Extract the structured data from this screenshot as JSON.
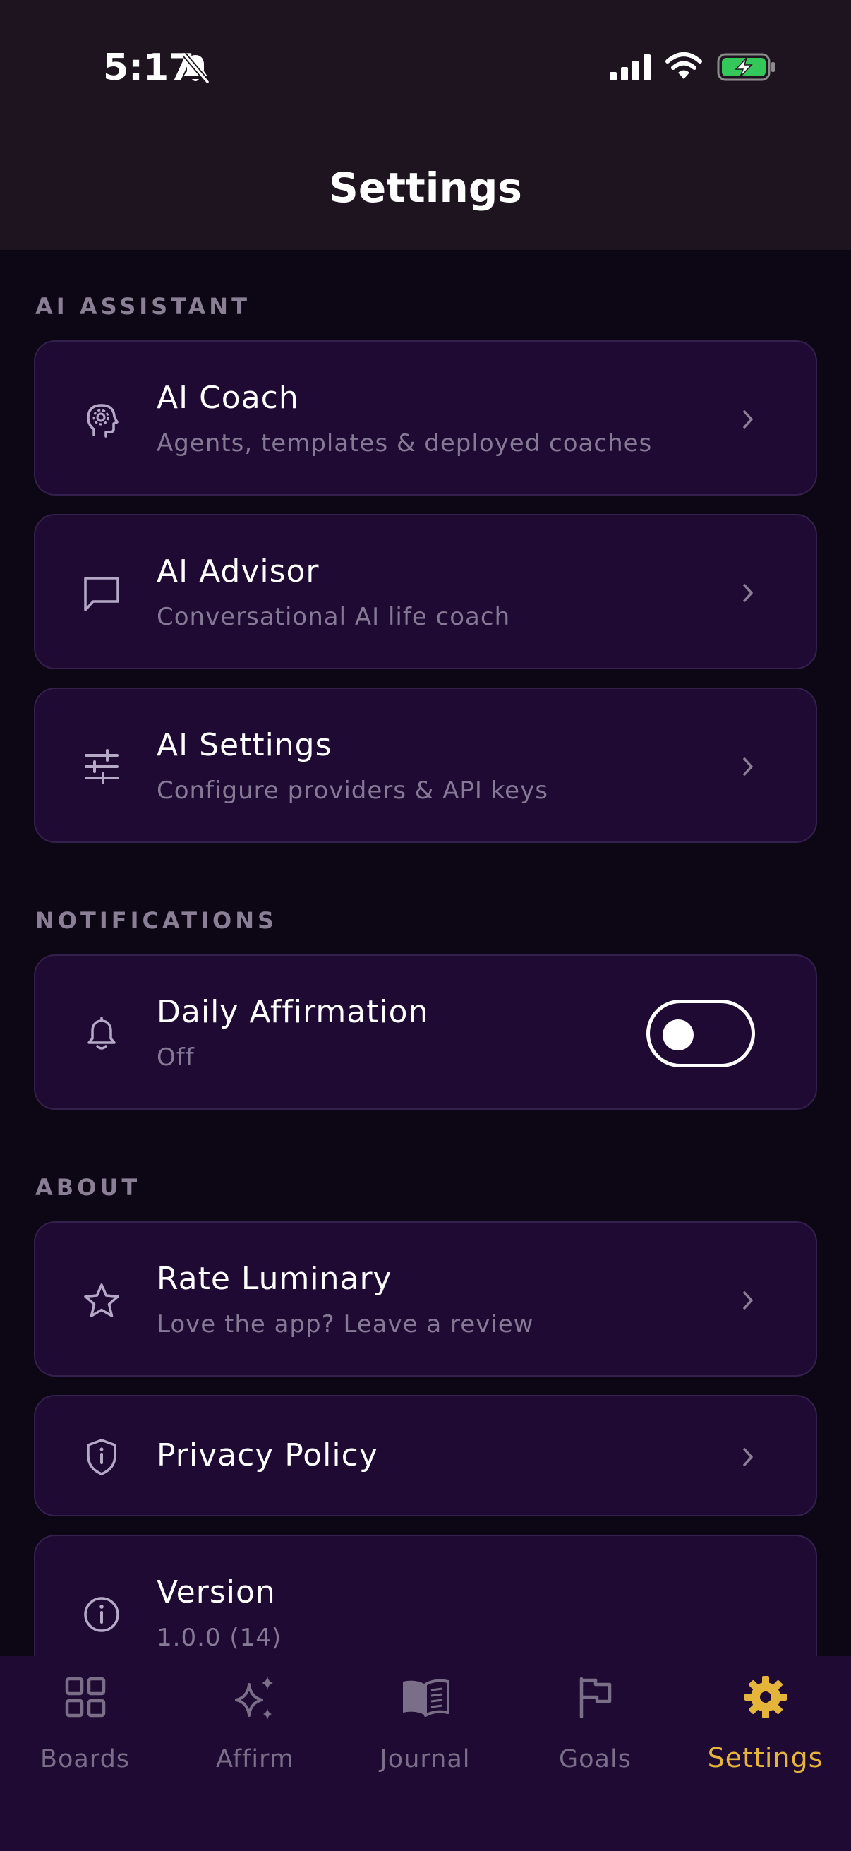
{
  "status_bar": {
    "time": "5:17"
  },
  "header": {
    "title": "Settings"
  },
  "sections": {
    "ai_assistant": {
      "label": "AI ASSISTANT"
    },
    "notifications": {
      "label": "NOTIFICATIONS"
    },
    "about": {
      "label": "ABOUT"
    }
  },
  "items": {
    "ai_coach": {
      "title": "AI Coach",
      "subtitle": "Agents, templates & deployed coaches",
      "icon": "brain-gear-icon"
    },
    "ai_advisor": {
      "title": "AI Advisor",
      "subtitle": "Conversational AI life coach",
      "icon": "chat-bubble-icon"
    },
    "ai_settings": {
      "title": "AI Settings",
      "subtitle": "Configure providers & API keys",
      "icon": "sliders-icon"
    },
    "daily_affirmation": {
      "title": "Daily Affirmation",
      "subtitle": "Off",
      "icon": "bell-icon",
      "enabled": false
    },
    "rate": {
      "title": "Rate Luminary",
      "subtitle": "Love the app? Leave a review",
      "icon": "star-icon"
    },
    "privacy": {
      "title": "Privacy Policy",
      "icon": "shield-icon"
    },
    "version": {
      "title": "Version",
      "subtitle": "1.0.0 (14)",
      "icon": "info-icon"
    }
  },
  "tabs": [
    {
      "label": "Boards",
      "icon": "grid-icon",
      "active": false
    },
    {
      "label": "Affirm",
      "icon": "sparkles-icon",
      "active": false
    },
    {
      "label": "Journal",
      "icon": "book-icon",
      "active": false
    },
    {
      "label": "Goals",
      "icon": "flag-icon",
      "active": false
    },
    {
      "label": "Settings",
      "icon": "gear-icon",
      "active": true
    }
  ],
  "colors": {
    "background": "#0d0614",
    "header_bg": "#1d1420",
    "card_bg": "#1f0a33",
    "card_border": "#33204c",
    "muted_text": "#857995",
    "accent": "#e4b53a",
    "battery_green": "#34c759"
  }
}
